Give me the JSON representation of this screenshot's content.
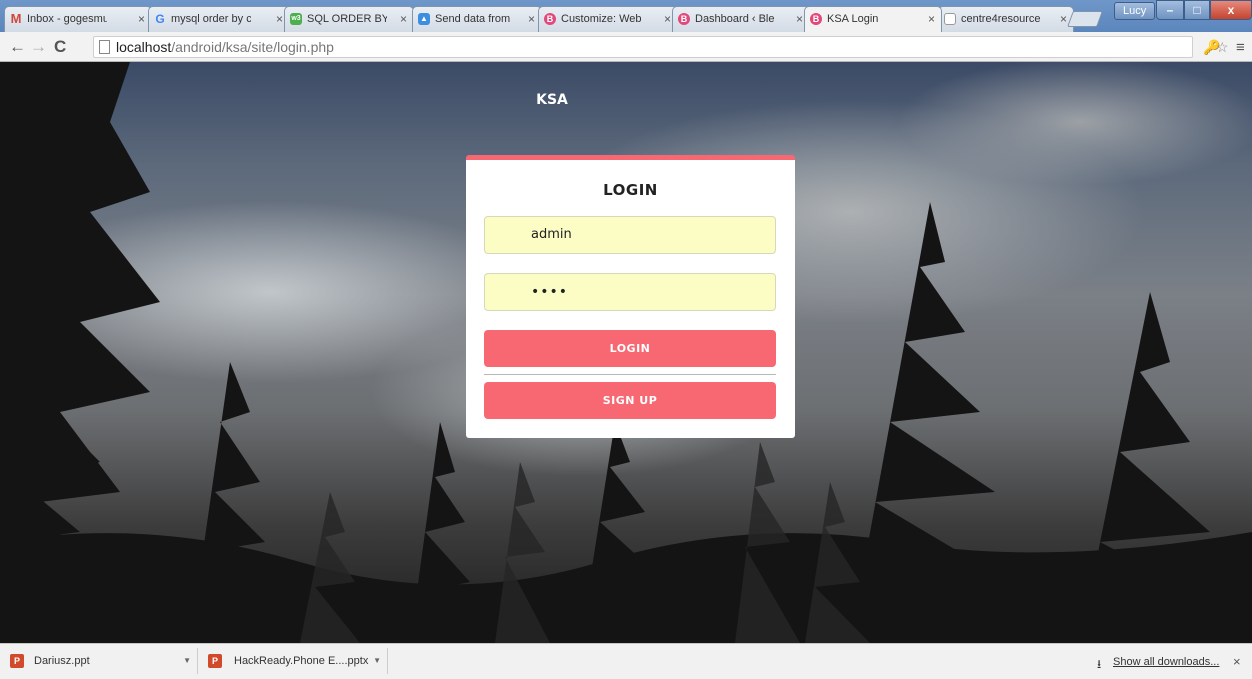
{
  "browser": {
    "tabs": [
      {
        "title": "Inbox - gogesmu",
        "icon": "gmail-icon",
        "icon_color": "#d44638",
        "icon_glyph": "M"
      },
      {
        "title": "mysql order by c",
        "icon": "google-icon",
        "icon_color": "#4285f4",
        "icon_glyph": "G"
      },
      {
        "title": "SQL ORDER BY K",
        "icon": "w3schools-icon",
        "icon_color": "#4caf50",
        "icon_glyph": "w3"
      },
      {
        "title": "Send data from",
        "icon": "android-icon",
        "icon_color": "#3b8ee0",
        "icon_glyph": "▲"
      },
      {
        "title": "Customize: Web",
        "icon": "wordpress-icon",
        "icon_color": "#e0497a",
        "icon_glyph": "B"
      },
      {
        "title": "Dashboard ‹ Ble",
        "icon": "wordpress-icon",
        "icon_color": "#e0497a",
        "icon_glyph": "B"
      },
      {
        "title": "KSA Login",
        "icon": "ksa-icon",
        "icon_color": "#e0497a",
        "icon_glyph": "B",
        "active": true
      },
      {
        "title": "centre4resource",
        "icon": "page-icon",
        "icon_color": "#999999",
        "icon_glyph": ""
      }
    ],
    "profile_name": "Lucy",
    "url": {
      "host": "localhost",
      "path": "/android/ksa/site/login.php"
    }
  },
  "page": {
    "brand": "KSA",
    "login_title": "LOGIN",
    "username_value": "admin",
    "password_value": "••••",
    "login_button": "LOGIN",
    "signup_button": "SIGN UP",
    "accent_color": "#f76872",
    "input_bg_color": "#fbfdc4"
  },
  "downloads": {
    "items": [
      {
        "name": "Dariusz.ppt"
      },
      {
        "name": "HackReady.Phone E....pptx"
      }
    ],
    "show_all": "Show all downloads..."
  }
}
